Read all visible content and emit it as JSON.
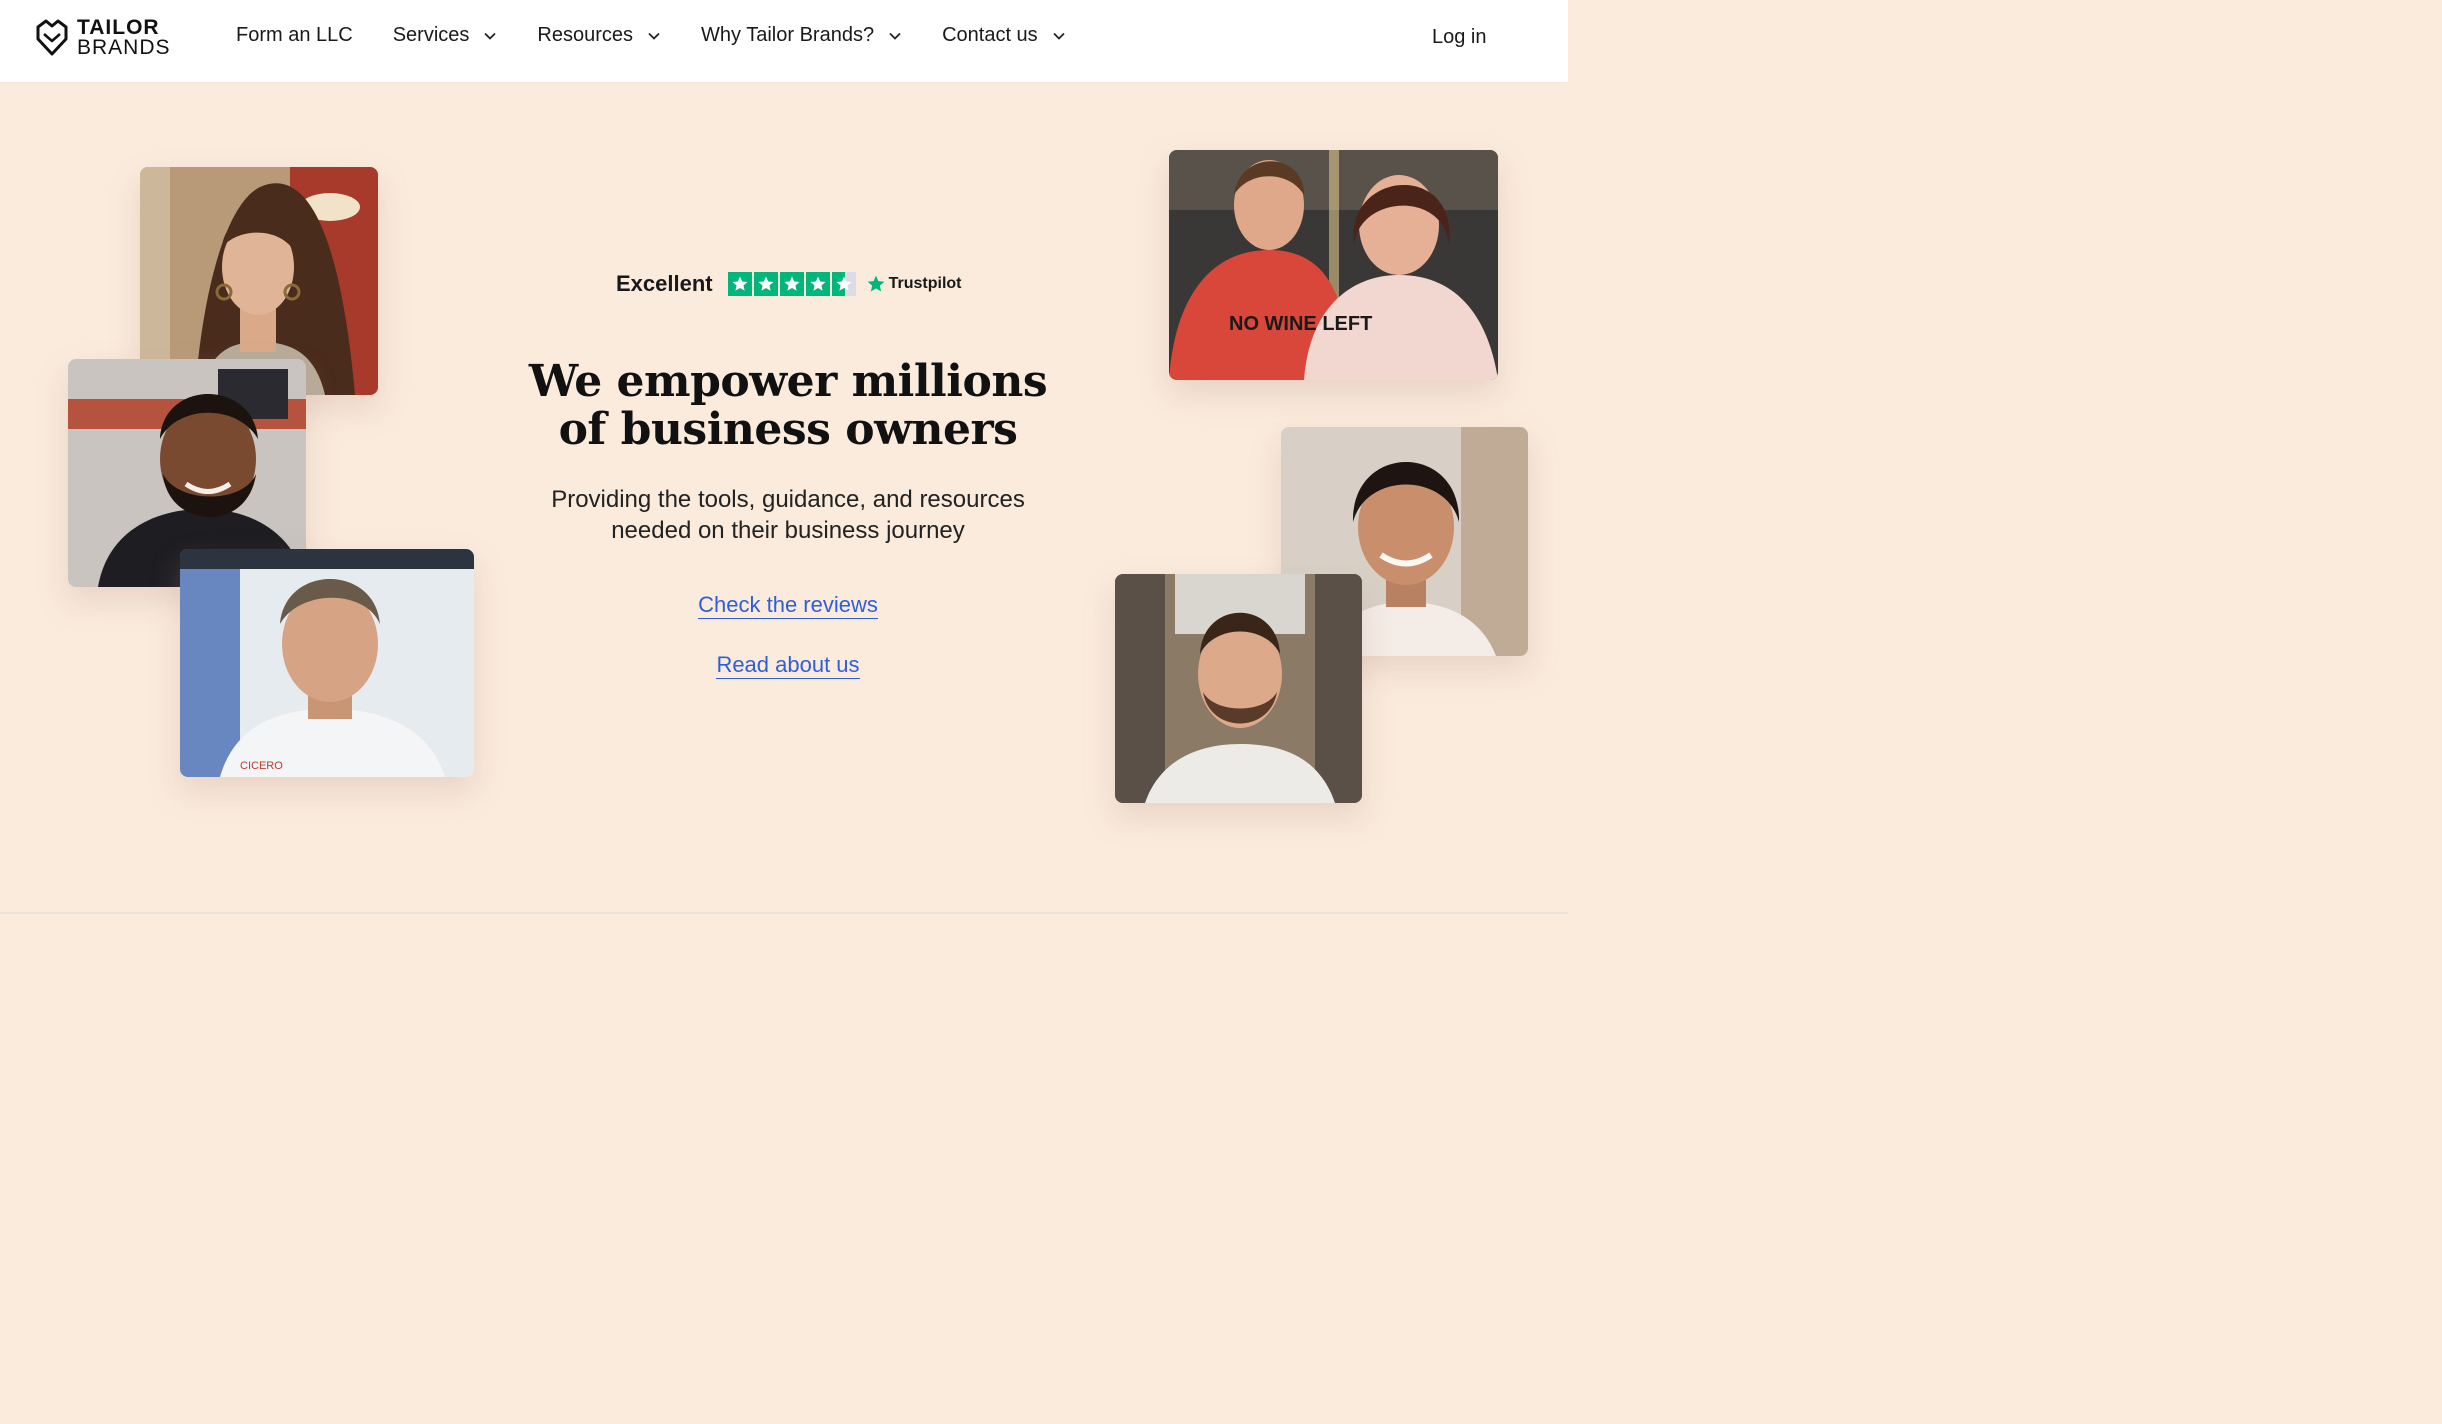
{
  "header": {
    "logo": {
      "line1": "TAILOR",
      "line2": "BRANDS"
    },
    "nav": [
      {
        "label": "Form an LLC",
        "dropdown": false
      },
      {
        "label": "Services",
        "dropdown": true
      },
      {
        "label": "Resources",
        "dropdown": true
      },
      {
        "label": "Why Tailor Brands?",
        "dropdown": true
      },
      {
        "label": "Contact us",
        "dropdown": true
      }
    ],
    "login": "Log in"
  },
  "hero": {
    "rating": {
      "label": "Excellent",
      "stars": 4.5,
      "brand": "Trustpilot"
    },
    "headline_line1": "We empower millions",
    "headline_line2": "of business owners",
    "subtitle_line1": "Providing the tools, guidance, and resources",
    "subtitle_line2": "needed on their business journey",
    "cta_reviews": "Check the reviews",
    "cta_about": "Read about us"
  },
  "photos": {
    "shirt_text": "NO WINE LEFT",
    "jacket_text": "CICERO"
  },
  "colors": {
    "background": "#faebdc",
    "link": "#2f5fd8",
    "trustpilot_green": "#00b67a"
  }
}
